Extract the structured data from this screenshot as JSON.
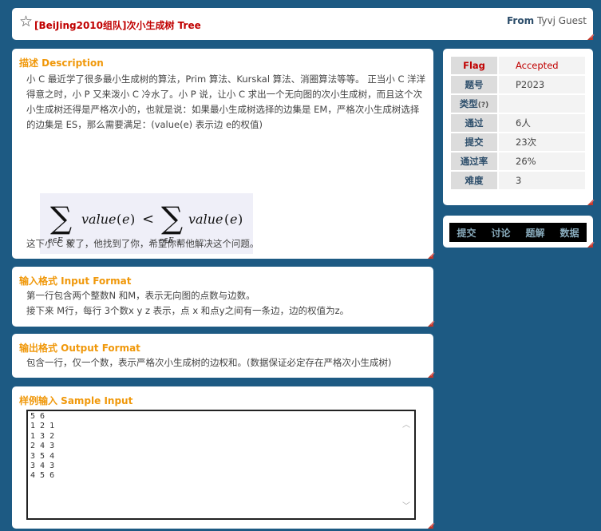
{
  "header": {
    "title": "[BeiJing2010组队]次小生成树 Tree",
    "from_label": "From",
    "from_user": "Tyvj Guest"
  },
  "description": {
    "title": "描述 Description",
    "text": "小 C 最近学了很多最小生成树的算法，Prim 算法、Kurskal 算法、消圈算法等等。 正当小 C 洋洋得意之时，小 P 又来泼小 C 冷水了。小 P 说，让小 C 求出一个无向图的次小生成树，而且这个次小生成树还得是严格次小的，也就是说：如果最小生成树选择的边集是 EM，严格次小生成树选择的边集是 ES，那么需要满足：(value(e) 表示边 e的权值)",
    "after": "这下小 C 蒙了，他找到了你，希望你帮他解决这个问题。"
  },
  "input_format": {
    "title": "输入格式 Input Format",
    "line1": "第一行包含两个整数N 和M，表示无向图的点数与边数。",
    "line2": "接下来 M行，每行 3个数x y z 表示，点 x 和点y之间有一条边，边的权值为z。"
  },
  "output_format": {
    "title": "输出格式 Output Format",
    "text": "包含一行，仅一个数，表示严格次小生成树的边权和。(数据保证必定存在严格次小生成树)"
  },
  "sample_input": {
    "title": "样例输入 Sample Input",
    "lines": [
      "5 6",
      "1 2 1",
      "1 3 2",
      "2 4 3",
      "3 5 4",
      "3 4 3",
      "4 5 6"
    ]
  },
  "info": {
    "flag_label": "Flag",
    "flag_value": "Accepted",
    "id_label": "题号",
    "id_value": "P2023",
    "type_label": "类型",
    "type_hint": "(?)",
    "type_value": "",
    "pass_label": "通过",
    "pass_value": "6人",
    "submit_label": "提交",
    "submit_value": "23次",
    "rate_label": "通过率",
    "rate_value": "26%",
    "difficulty_label": "难度",
    "difficulty_value": "3"
  },
  "links": {
    "submit": "提交",
    "discuss": "讨论",
    "solution": "题解",
    "data": "数据"
  },
  "colors": {
    "background": "#1d5a83",
    "title_red": "#c00000",
    "section_orange": "#f0980a"
  }
}
